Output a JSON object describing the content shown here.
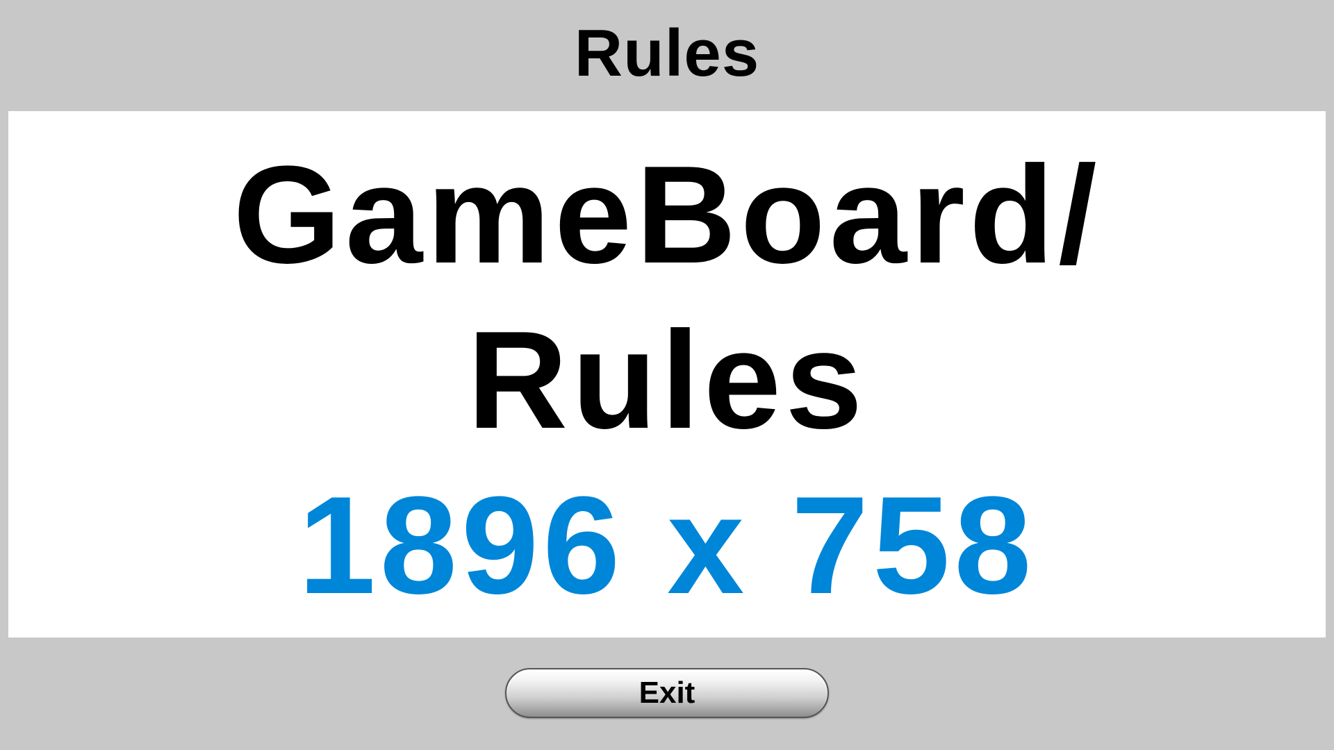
{
  "header": {
    "title": "Rules"
  },
  "board": {
    "line1": "GameBoard/",
    "line2": "Rules",
    "line3": "1896 x 758",
    "colors": {
      "text": "#000000",
      "dimensions_text": "#0086d8",
      "background": "#ffffff"
    }
  },
  "footer": {
    "exit_label": "Exit"
  },
  "colors": {
    "page_background": "#c8c8c8"
  }
}
